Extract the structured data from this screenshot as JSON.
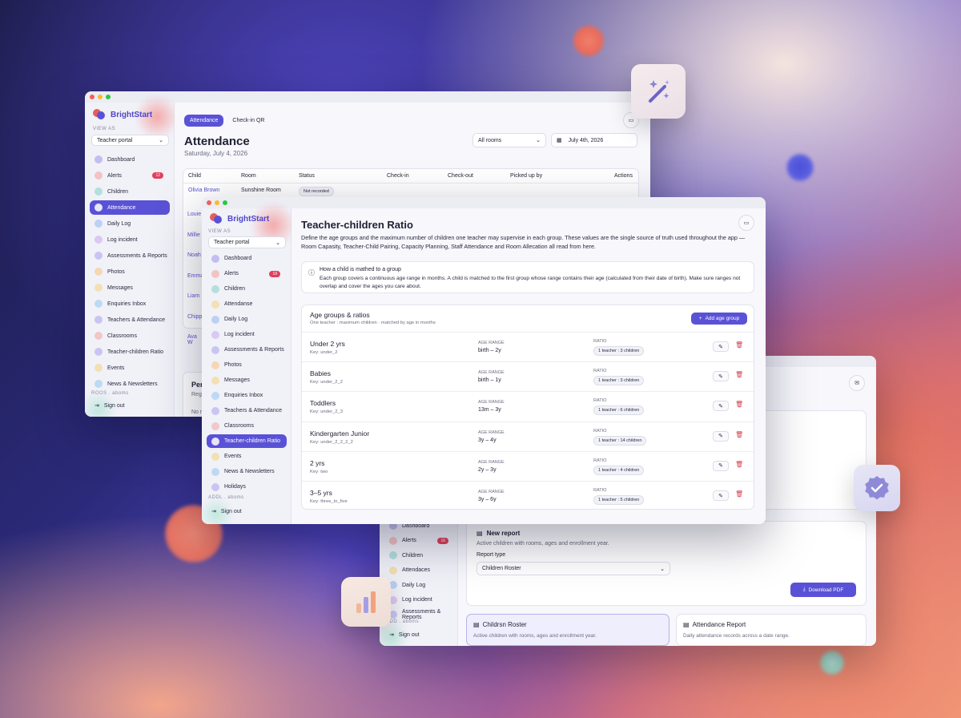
{
  "brand": {
    "name": "BrightStart",
    "view_as": "VIEW AS",
    "portal": "Teacher portal",
    "sign_out": "Sign out",
    "footer_hint": "ADDL . aboms"
  },
  "win_attendance": {
    "brand_name": "BrightStart",
    "view_as": "VIEW AS",
    "tabs": [
      "Attendance",
      "Check-in QR"
    ],
    "title": "Attendance",
    "date": "Saturday, July 4, 2026",
    "rooms_select": "All rooms",
    "date_picker": "July 4th, 2026",
    "columns": [
      "Child",
      "Room",
      "Status",
      "Check-in",
      "Check-out",
      "Picked up by",
      "Actions"
    ],
    "first_row": {
      "child": "Olivia Brown",
      "room": "Sunshine Room",
      "status": "Not recorded"
    },
    "names": [
      "Louie",
      "Millie",
      "Noah",
      "Emma",
      "Liam",
      "Chipp",
      "Ava W"
    ],
    "bottom_card_title": "Per",
    "bottom_card_sub": "Reg",
    "bottom_card_line": "No r",
    "footer_hint": "ROOS . aboms",
    "nav": [
      {
        "label": "Dashboard",
        "color": "#9a94e8"
      },
      {
        "label": "Alerts",
        "color": "#f39a9a",
        "badge": "12"
      },
      {
        "label": "Children",
        "color": "#7fd0c4"
      },
      {
        "label": "Attendance",
        "color": "#ffffff",
        "active": true
      },
      {
        "label": "Daily Log",
        "color": "#8fb6f0"
      },
      {
        "label": "Log incident",
        "color": "#c9a5ef"
      },
      {
        "label": "Assessments & Reports",
        "color": "#a7a1ef"
      },
      {
        "label": "Photos",
        "color": "#f4c27a"
      },
      {
        "label": "Messages",
        "color": "#f4d27a"
      },
      {
        "label": "Enquiries Inbox",
        "color": "#8fc6f0"
      },
      {
        "label": "Teachers & Attendance",
        "color": "#a7a1ef"
      },
      {
        "label": "Classrooms",
        "color": "#f0a4a4"
      },
      {
        "label": "Teacher-children Ratio",
        "color": "#a7a1ef"
      },
      {
        "label": "Events",
        "color": "#f4d27a"
      },
      {
        "label": "News & Newsletters",
        "color": "#8fc6f0"
      }
    ]
  },
  "win_ratio": {
    "nav": [
      {
        "label": "Dashboard",
        "color": "#9a94e8"
      },
      {
        "label": "Alerts",
        "color": "#f39a9a",
        "badge": "19"
      },
      {
        "label": "Children",
        "color": "#7fd0c4"
      },
      {
        "label": "Attendanse",
        "color": "#f4d27a"
      },
      {
        "label": "Daily Log",
        "color": "#8fb6f0"
      },
      {
        "label": "Log incident",
        "color": "#c9a5ef"
      },
      {
        "label": "Assessments & Reports",
        "color": "#a7a1ef"
      },
      {
        "label": "Photos",
        "color": "#f4c27a"
      },
      {
        "label": "Messages",
        "color": "#f4d27a"
      },
      {
        "label": "Enquiries Inbox",
        "color": "#8fc6f0"
      },
      {
        "label": "Teachers & Attendance",
        "color": "#a7a1ef"
      },
      {
        "label": "Classrooms",
        "color": "#f0a4a4"
      },
      {
        "label": "Teacher-children Ratio",
        "color": "#ffffff",
        "active": true
      },
      {
        "label": "Events",
        "color": "#f4d27a"
      },
      {
        "label": "News & Newsletters",
        "color": "#8fc6f0"
      },
      {
        "label": "Holidays",
        "color": "#a7a1ef"
      }
    ],
    "title": "Teacher-children Ratio",
    "description": "Define the age groups and the maximum number of children one teacher may supervise in each group. These values are the single source of truth used throughout the app — Room Capasity, Teacher-Child Pairing, Capacity Planning, Staff Attendance and Room Allecation all read from here.",
    "info_title": "How a child is mathed to a group",
    "info_body": "Each group covers a continuous age range in months. A child is matched to the first group whose range contains their age (calculated from their date of birth). Make sure ranges not overlap and cover the ages you care about.",
    "groups_title": "Age groups & ratios",
    "groups_sub": "One teacher : maximum children · matched by age in months",
    "add_button": "Add age group",
    "age_range_label": "AGE RANGE",
    "ratio_label": "RATIO",
    "groups": [
      {
        "name": "Under 2 yrs",
        "key": "Key: under_2",
        "range": "birth – 2y",
        "ratio": "1 teacher : 3 children"
      },
      {
        "name": "Babies",
        "key": "Key: under_2_2",
        "range": "birth – 1y",
        "ratio": "1 teacher : 3 children"
      },
      {
        "name": "Toddlers",
        "key": "Key: under_2_3",
        "range": "13m – 3y",
        "ratio": "1 teacher : 6 children"
      },
      {
        "name": "Kindergarten Junior",
        "key": "Key: under_2_2_2_2",
        "range": "3y – 4y",
        "ratio": "1 teacher : 14 children"
      },
      {
        "name": "2 yrs",
        "key": "Key: two",
        "range": "2y – 3y",
        "ratio": "1 teacher : 4 children"
      },
      {
        "name": "3–5 yrs",
        "key": "Key: three_to_five",
        "range": "3y – 6y",
        "ratio": "1 teacher : 5 children"
      }
    ]
  },
  "win_reports": {
    "nav": [
      {
        "label": "Dashboard",
        "color": "#9a94e8"
      },
      {
        "label": "Alerts",
        "color": "#f39a9a",
        "badge": "16"
      },
      {
        "label": "Children",
        "color": "#7fd0c4"
      },
      {
        "label": "Attendaces",
        "color": "#f4d27a"
      },
      {
        "label": "Daily Log",
        "color": "#8fb6f0"
      },
      {
        "label": "Log incident",
        "color": "#c9a5ef"
      },
      {
        "label": "Assessments & Reports",
        "color": "#a7a1ef"
      }
    ],
    "new_report_title": "New report",
    "new_report_sub": "Active children with rooms, ages and enrollment year.",
    "report_type_label": "Report type",
    "report_type_value": "Children Roster",
    "download_button": "Download PDF",
    "card1_title": "Childrsn Roster",
    "card1_sub": "Active children with rooms, ages and enrollment year.",
    "card2_title": "Attendance Report",
    "card2_sub": "Daily attendance records across a date range.",
    "footer_hint": "ADD . aboms"
  },
  "colors": {
    "accent": "#5a52d6",
    "danger": "#d43c4c"
  }
}
